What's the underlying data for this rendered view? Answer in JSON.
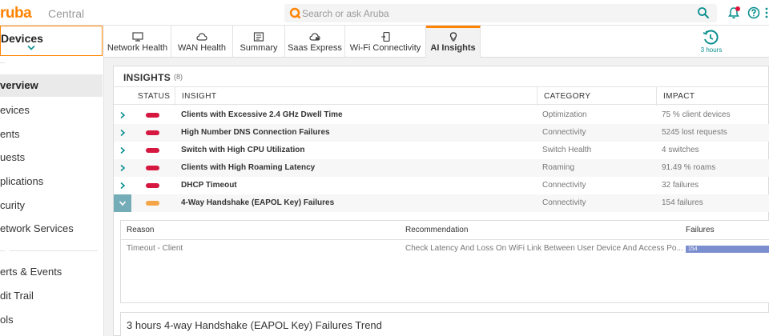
{
  "header": {
    "logo_text": "ruba",
    "logo_sub": "Central",
    "search": {
      "placeholder": "Search or ask Aruba"
    },
    "icons": {
      "search": "search-icon",
      "notifications": "bell-icon",
      "help": "help-icon",
      "more": "more-icon"
    },
    "accent_color": "#ff8300"
  },
  "sidebar": {
    "context_label": "Devices",
    "items": [
      {
        "label": "verview",
        "active": true
      },
      {
        "label": "evices"
      },
      {
        "label": "ents"
      },
      {
        "label": "uests"
      },
      {
        "label": "plications"
      },
      {
        "label": "curity"
      },
      {
        "label": "etwork Services"
      },
      {
        "label": "erts & Events"
      },
      {
        "label": "dit Trail"
      },
      {
        "label": "ols"
      }
    ]
  },
  "tabs": [
    {
      "label": "Network Health",
      "icon": "monitor-icon"
    },
    {
      "label": "WAN Health",
      "icon": "cloud-icon"
    },
    {
      "label": "Summary",
      "icon": "summary-icon"
    },
    {
      "label": "Saas Express",
      "icon": "cloud-lock-icon"
    },
    {
      "label": "Wi-Fi Connectivity",
      "icon": "phone-icon"
    },
    {
      "label": "AI Insights",
      "icon": "lightbulb-icon",
      "active": true
    }
  ],
  "time_range": {
    "label": "3 hours",
    "icon": "clock-history-icon"
  },
  "insights": {
    "title": "INSIGHTS",
    "count": "(8)",
    "columns": [
      "STATUS",
      "INSIGHT",
      "CATEGORY",
      "IMPACT"
    ],
    "rows": [
      {
        "insight": "Clients with Excessive 2.4 GHz Dwell Time",
        "category": "Optimization",
        "impact": "75 % client devices",
        "status_color": "#d6173f"
      },
      {
        "insight": "High Number DNS Connection Failures",
        "category": "Connectivity",
        "impact": "5245 lost requests",
        "status_color": "#d6173f"
      },
      {
        "insight": "Switch with High CPU Utilization",
        "category": "Switch Health",
        "impact": "4 switches",
        "status_color": "#d6173f"
      },
      {
        "insight": "Clients with High Roaming Latency",
        "category": "Roaming",
        "impact": "91.49 % roams",
        "status_color": "#d6173f"
      },
      {
        "insight": "DHCP Timeout",
        "category": "Connectivity",
        "impact": "32 failures",
        "status_color": "#d6173f"
      },
      {
        "insight": "4-Way Handshake (EAPOL Key) Failures",
        "category": "Connectivity",
        "impact": "154 failures",
        "status_color": "#f5a547",
        "expanded": true
      }
    ],
    "detail": {
      "columns": [
        "Reason",
        "Recommendation",
        "Failures"
      ],
      "row": {
        "reason": "Timeout - Client",
        "recommendation": "Check Latency And Loss On WiFi Link Between User Device And Access Po...",
        "failures": "154"
      }
    },
    "trend_title": "3 hours 4-way Handshake (EAPOL Key) Failures Trend"
  }
}
